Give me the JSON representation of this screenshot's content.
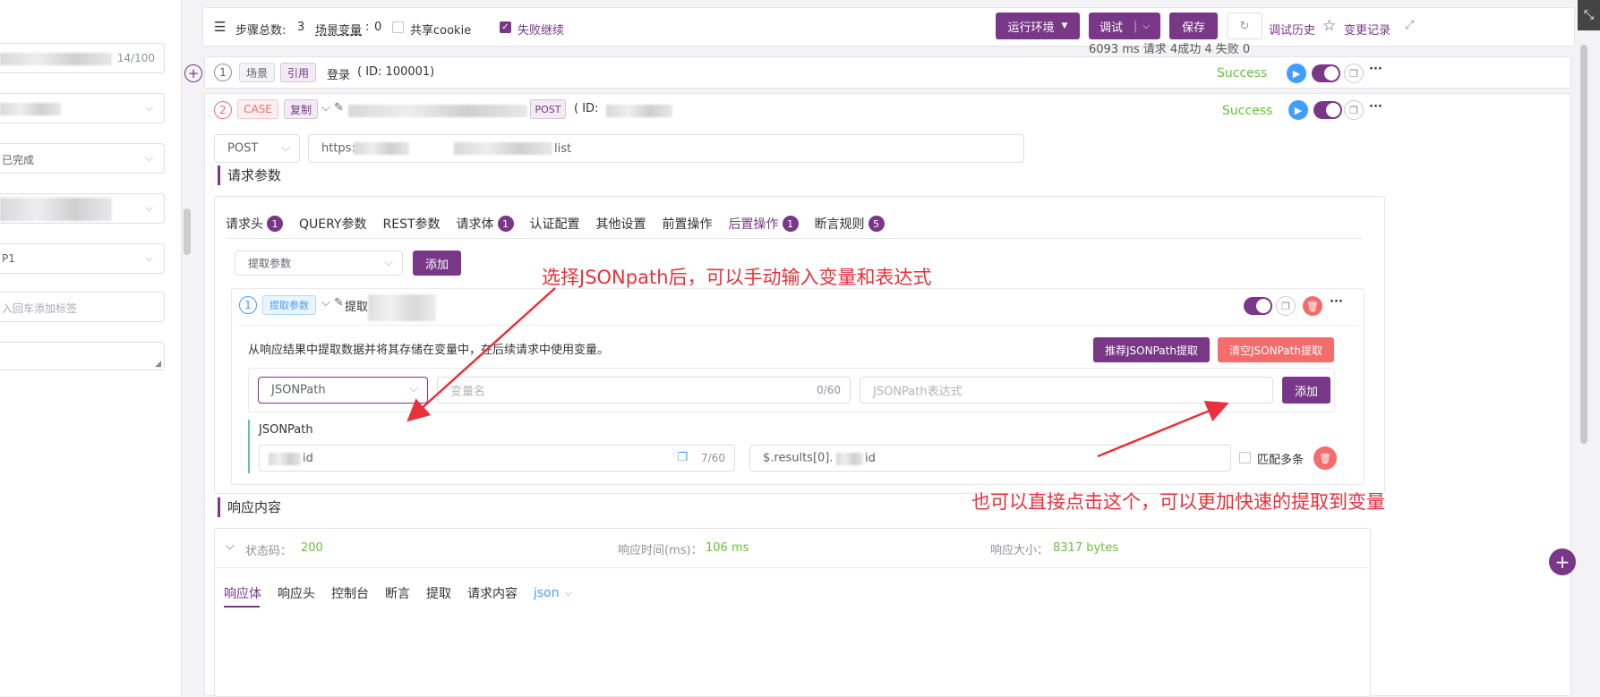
{
  "left": {
    "counter": "14/100",
    "status_value": "已完成",
    "priority_value": "P1",
    "tag_placeholder": "入回车添加标签"
  },
  "toolbar": {
    "steps_label": "步骤总数:",
    "steps_count": "3",
    "scene_var_label": "场景变量",
    "scene_var_count": "0",
    "share_cookie": "共享cookie",
    "fail_continue": "失败继续",
    "env_button": "运行环境",
    "debug_button": "调试",
    "save_button": "保存",
    "history_link": "调试历史",
    "changelog_link": "变更记录",
    "summary": "6093 ms 请求 4成功 4 失败 0"
  },
  "step1": {
    "index": "1",
    "type_tag": "场景",
    "ref_tag": "引用",
    "name": "登录",
    "id_text": "( ID: 100001)",
    "status": "Success"
  },
  "step2": {
    "index": "2",
    "type_tag": "CASE",
    "copy_tag": "复制",
    "method_tag": "POST",
    "id_text": "( ID:",
    "status": "Success",
    "method": "POST",
    "url_prefix": "https:/",
    "url_suffix": "list"
  },
  "request": {
    "title": "请求参数",
    "tabs": [
      {
        "label": "请求头",
        "badge": "1"
      },
      {
        "label": "QUERY参数",
        "badge": ""
      },
      {
        "label": "REST参数",
        "badge": ""
      },
      {
        "label": "请求体",
        "badge": "1"
      },
      {
        "label": "认证配置",
        "badge": ""
      },
      {
        "label": "其他设置",
        "badge": ""
      },
      {
        "label": "前置操作",
        "badge": ""
      },
      {
        "label": "后置操作",
        "badge": "1"
      },
      {
        "label": "断言规则",
        "badge": "5"
      }
    ],
    "extract_select_placeholder": "提取参数",
    "add_button": "添加"
  },
  "extract": {
    "index": "1",
    "tag": "提取参数",
    "name_prefix": "提取",
    "description": "从响应结果中提取数据并将其存储在变量中，在后续请求中使用变量。",
    "recommend_button": "推荐JSONPath提取",
    "clear_button": "清空JSONPath提取",
    "type_value": "JSONPath",
    "var_placeholder": "变量名",
    "var_count": "0/60",
    "expr_placeholder": "JSONPath表达式",
    "add_button": "添加",
    "section_label": "JSONPath",
    "row_var_suffix": "id",
    "row_var_count": "7/60",
    "row_expr_prefix": "$.results[0].",
    "row_expr_suffix": "id",
    "multi_match": "匹配多条"
  },
  "response": {
    "title": "响应内容",
    "status_label": "状态码：",
    "status_value": "200",
    "time_label": "响应时间(ms)：",
    "time_value": "106 ms",
    "size_label": "响应大小：",
    "size_value": "8317 bytes",
    "tabs": [
      "响应体",
      "响应头",
      "控制台",
      "断言",
      "提取",
      "请求内容"
    ],
    "format": "json"
  },
  "annotations": {
    "top": "选择JSONpath后，可以手动输入变量和表达式",
    "bottom": "也可以直接点击这个，可以更加快速的提取到变量"
  },
  "colors": {
    "primary": "#783887",
    "success": "#67c23a",
    "danger": "#f56c6c",
    "annotation": "#e8313a"
  }
}
